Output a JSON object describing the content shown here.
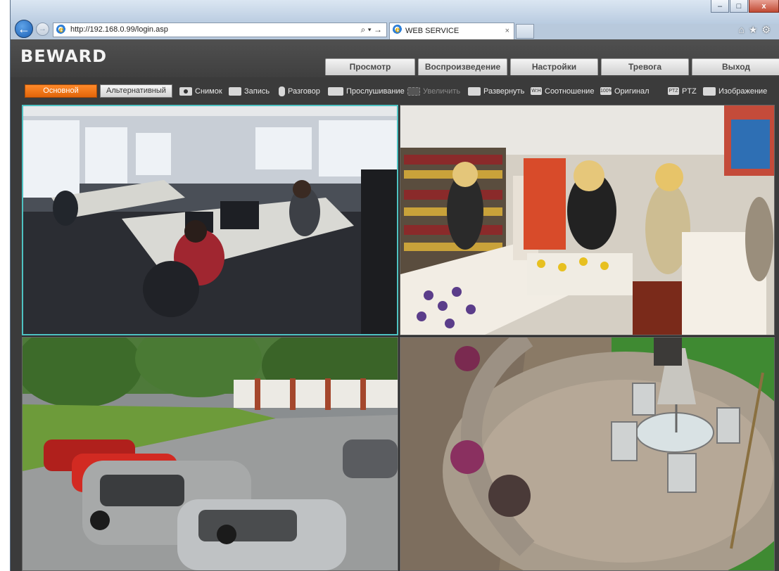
{
  "browser": {
    "url": "http://192.168.0.99/login.asp",
    "tab_title": "WEB SERVICE",
    "tab_close": "×",
    "window_controls": [
      "minimize",
      "maximize",
      "close"
    ]
  },
  "app": {
    "logo": "BEWARD",
    "menu": [
      "Просмотр",
      "Воспроизведение",
      "Настройки",
      "Тревога",
      "Выход"
    ],
    "active_menu": "Просмотр"
  },
  "toolbar": {
    "stream_main": "Основной",
    "stream_alt": "Альтернативный",
    "snapshot": "Снимок",
    "record": "Запись",
    "talk": "Разговор",
    "listen": "Прослушивание",
    "zoom": "Увеличить",
    "expand": "Развернуть",
    "ratio_badge": "W:H",
    "ratio": "Соотношение",
    "original_badge": "100%",
    "original": "Оригинал",
    "ptz_badge": "PTZ",
    "ptz": "PTZ",
    "image": "Изображение"
  },
  "video_views": [
    "office",
    "store",
    "parking",
    "patio"
  ],
  "colors": {
    "active_stream": "#f07a1a",
    "selected_view_border": "#4ec2c2",
    "page_background": "#3b3b3b"
  }
}
